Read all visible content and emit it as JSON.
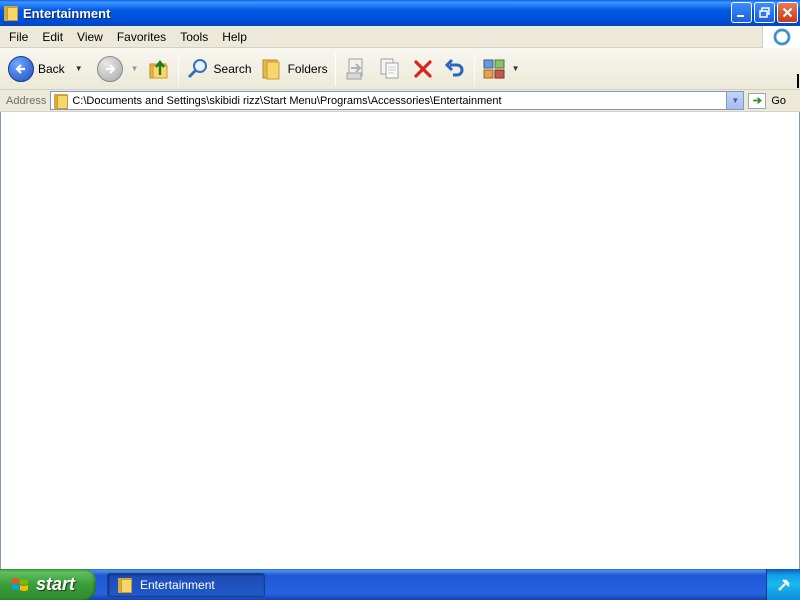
{
  "window": {
    "title": "Entertainment",
    "buttons": {
      "minimize": "_",
      "maximize": "❐",
      "close": "✕"
    }
  },
  "menubar": {
    "items": [
      "File",
      "Edit",
      "View",
      "Favorites",
      "Tools",
      "Help"
    ]
  },
  "toolbar": {
    "back_label": "Back",
    "search_label": "Search",
    "folders_label": "Folders"
  },
  "address": {
    "label": "Address",
    "value": "C:\\Documents and Settings\\skibidi rizz\\Start Menu\\Programs\\Accessories\\Entertainment",
    "go_label": "Go"
  },
  "taskbar": {
    "start_label": "start",
    "tasks": [
      "Entertainment"
    ]
  },
  "colors": {
    "titlebar": "#0058e6",
    "taskbar": "#2663e0",
    "start_green": "#3a9d3a",
    "chrome": "#ece9d8"
  },
  "icons": [
    "folder-icon",
    "xp-logo-icon",
    "back-icon",
    "forward-icon",
    "up-folder-icon",
    "search-icon",
    "folders-icon",
    "move-to-icon",
    "copy-to-icon",
    "delete-icon",
    "undo-icon",
    "views-icon",
    "go-arrow-icon",
    "windows-flag-icon",
    "tray-icon"
  ]
}
